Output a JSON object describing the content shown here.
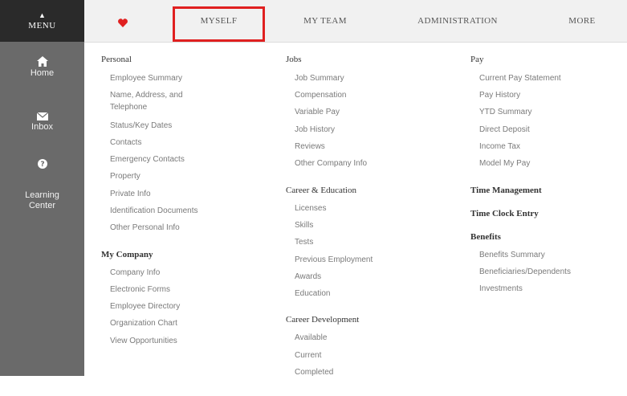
{
  "sidebar": {
    "menu_caret": "▲",
    "menu_label": "MENU",
    "items": [
      {
        "label": "Home",
        "icon": "home-icon"
      },
      {
        "label": "Inbox",
        "icon": "envelope-icon"
      },
      {
        "label": "",
        "icon": "help-icon"
      },
      {
        "label": "Learning Center",
        "icon": "learning-center-icon"
      }
    ]
  },
  "topnav": {
    "favorite_icon": "heart-icon",
    "accent": "#e02020",
    "tabs": [
      "MYSELF",
      "MY TEAM",
      "ADMINISTRATION",
      "MORE"
    ],
    "active_tab": "MYSELF"
  },
  "columns": {
    "personal": {
      "title": "Personal",
      "links": [
        "Employee Summary",
        "Name, Address, and",
        "Telephone",
        "Status/Key Dates",
        "Contacts",
        "Emergency Contacts",
        "Property",
        "Private Info",
        "Identification Documents",
        "Other Personal Info"
      ]
    },
    "my_company": {
      "title": "My Company",
      "links": [
        "Company Info",
        "Electronic Forms",
        "Employee Directory",
        "Organization Chart",
        "View Opportunities"
      ]
    },
    "jobs": {
      "title": "Jobs",
      "links": [
        "Job Summary",
        "Compensation",
        "Variable Pay",
        "Job History",
        "Reviews",
        "Other Company Info"
      ]
    },
    "career_education": {
      "title": "Career & Education",
      "links": [
        "Licenses",
        "Skills",
        "Tests",
        "Previous Employment",
        "Awards",
        "Education"
      ]
    },
    "career_development": {
      "title": "Career Development",
      "links": [
        "Available",
        "Current",
        "Completed"
      ]
    },
    "pay": {
      "title": "Pay",
      "links": [
        "Current Pay Statement",
        "Pay History",
        "YTD Summary",
        "Direct Deposit",
        "Income Tax",
        "Model My Pay"
      ]
    },
    "time_management": {
      "title": "Time Management"
    },
    "time_clock": {
      "title": "Time Clock Entry"
    },
    "benefits": {
      "title": "Benefits",
      "links": [
        "Benefits Summary",
        "Beneficiaries/Dependents",
        "Investments"
      ]
    }
  }
}
